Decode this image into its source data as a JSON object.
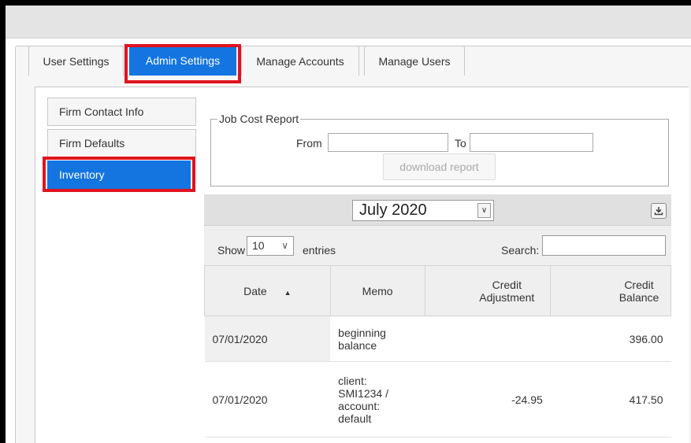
{
  "tabs": [
    {
      "label": "User Settings"
    },
    {
      "label": "Admin Settings"
    },
    {
      "label": "Manage Accounts"
    },
    {
      "label": "Manage Users"
    }
  ],
  "sidebar": {
    "items": [
      {
        "label": "Firm Contact Info"
      },
      {
        "label": "Firm Defaults"
      },
      {
        "label": "Inventory"
      }
    ]
  },
  "job_cost_report": {
    "legend": "Job Cost Report",
    "from_label": "From",
    "from_value": "",
    "to_label": "To",
    "to_value": "",
    "download_label": "download report"
  },
  "month_selector": {
    "value": "July 2020",
    "icon": "download-icon"
  },
  "filter": {
    "show_label": "Show",
    "entries_value": "10",
    "entries_label": "entries",
    "search_label": "Search:",
    "search_value": ""
  },
  "table": {
    "headers": [
      "Date",
      "Memo",
      "Credit Adjustment",
      "Credit Balance"
    ],
    "rows": [
      {
        "date": "07/01/2020",
        "memo": "beginning balance",
        "adjustment": "",
        "balance": "396.00"
      },
      {
        "date": "07/01/2020",
        "memo": "client: SMI1234 / account: default",
        "adjustment": "-24.95",
        "balance": "417.50"
      }
    ]
  },
  "colors": {
    "accent": "#1475e1",
    "highlight": "#e0141e",
    "border": "#000000"
  }
}
